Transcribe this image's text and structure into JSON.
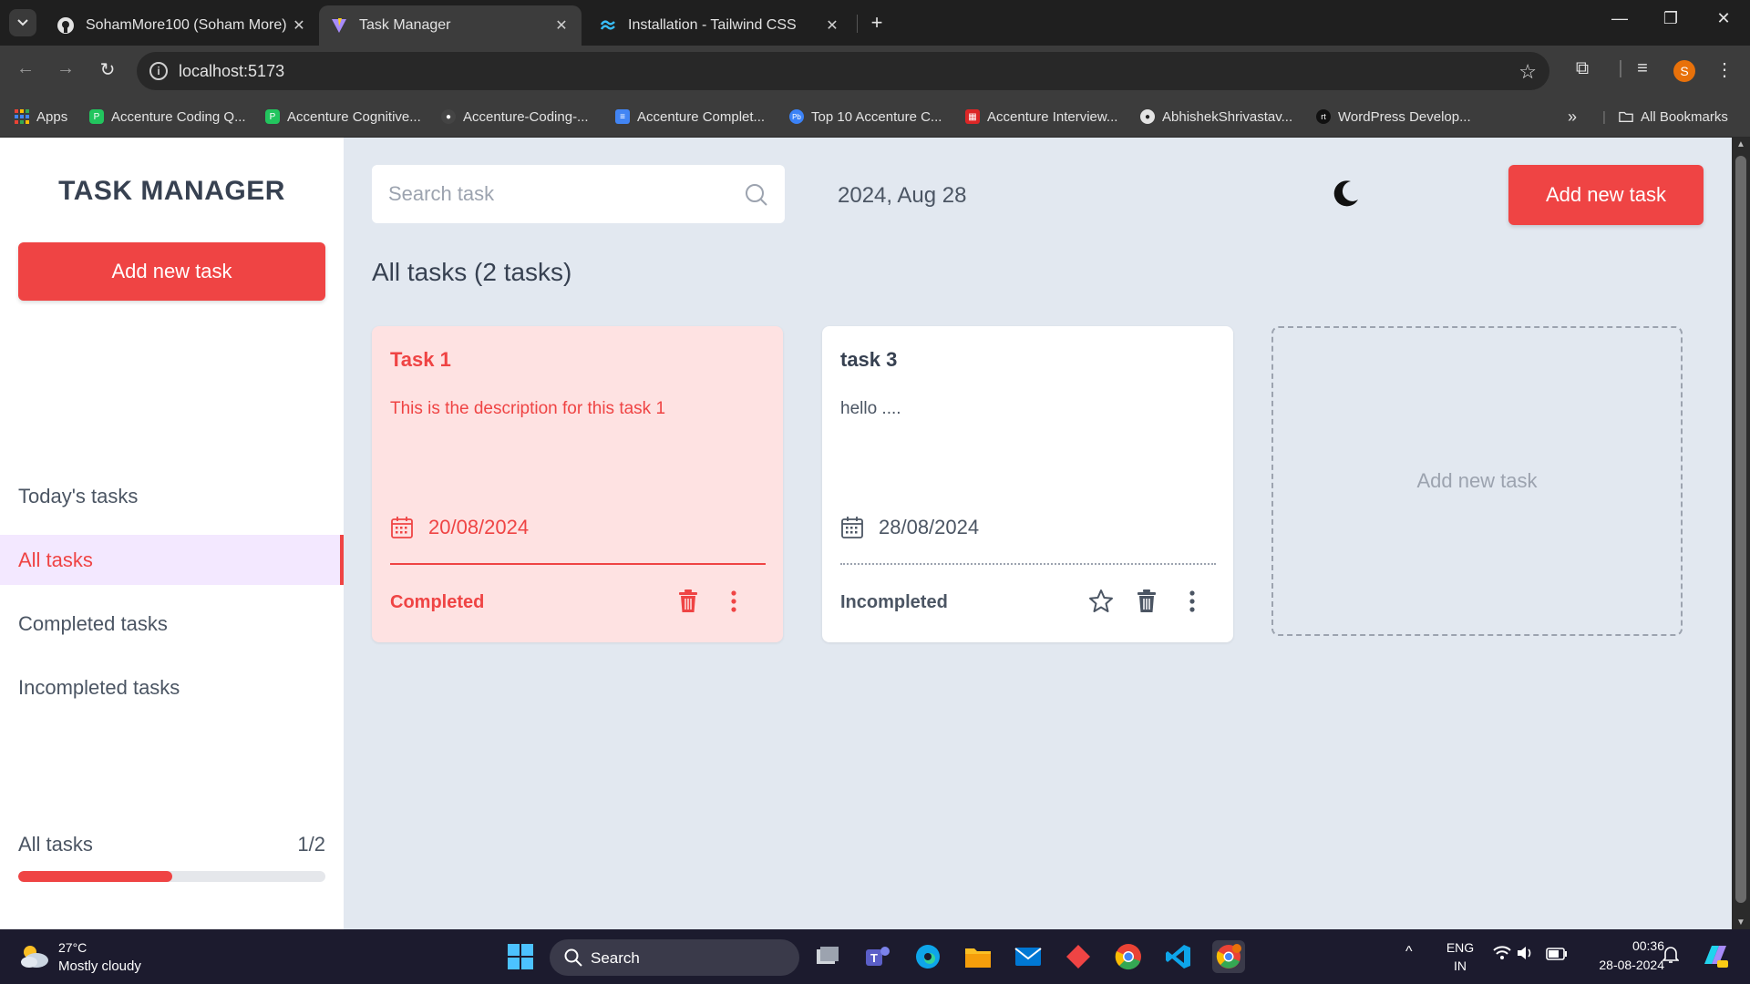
{
  "browser": {
    "tabs": [
      {
        "title": "SohamMore100 (Soham More)",
        "icon": "github-icon",
        "active": false
      },
      {
        "title": "Task Manager",
        "icon": "vite-icon",
        "active": true
      },
      {
        "title": "Installation - Tailwind CSS",
        "icon": "tailwind-icon",
        "active": false
      }
    ],
    "url": "localhost:5173",
    "profile_initial": "S",
    "bookmarks": [
      {
        "label": "Apps",
        "icon": "apps-grid-icon"
      },
      {
        "label": "Accenture Coding Q...",
        "icon": "bookmark-green-icon"
      },
      {
        "label": "Accenture Cognitive...",
        "icon": "bookmark-green-icon"
      },
      {
        "label": "Accenture-Coding-...",
        "icon": "github-icon"
      },
      {
        "label": "Accenture Complet...",
        "icon": "docs-icon"
      },
      {
        "label": "Top 10 Accenture C...",
        "icon": "pb-icon"
      },
      {
        "label": "Accenture Interview...",
        "icon": "bookmark-red-icon"
      },
      {
        "label": "AbhishekShrivastav...",
        "icon": "github-icon"
      },
      {
        "label": "WordPress Develop...",
        "icon": "rt-icon"
      }
    ],
    "all_bookmarks_label": "All Bookmarks"
  },
  "sidebar": {
    "brand": "TASK MANAGER",
    "add_button": "Add new task",
    "nav": [
      {
        "label": "Today's tasks",
        "active": false
      },
      {
        "label": "All tasks",
        "active": true
      },
      {
        "label": "Completed tasks",
        "active": false
      },
      {
        "label": "Incompleted tasks",
        "active": false
      }
    ],
    "progress": {
      "label": "All tasks",
      "count": "1/2",
      "fraction": 0.5
    }
  },
  "header": {
    "search_placeholder": "Search task",
    "date": "2024, Aug 28",
    "add_button": "Add new task"
  },
  "main": {
    "heading": "All tasks (2 tasks)",
    "tasks": [
      {
        "title": "Task 1",
        "description": "This is the description for this task 1",
        "date": "20/08/2024",
        "status": "Completed",
        "completed": true
      },
      {
        "title": "task 3",
        "description": "hello ....",
        "date": "28/08/2024",
        "status": "Incompleted",
        "completed": false
      }
    ],
    "add_card_label": "Add new task"
  },
  "taskbar": {
    "weather_temp": "27°C",
    "weather_desc": "Mostly cloudy",
    "search_label": "Search",
    "lang_line1": "ENG",
    "lang_line2": "IN",
    "time": "00:36",
    "date": "28-08-2024"
  },
  "colors": {
    "accent": "#ef4444",
    "app_bg": "#e2e8f0",
    "completed_card_bg": "#fee2e2",
    "active_nav_bg": "#f3e8ff"
  }
}
